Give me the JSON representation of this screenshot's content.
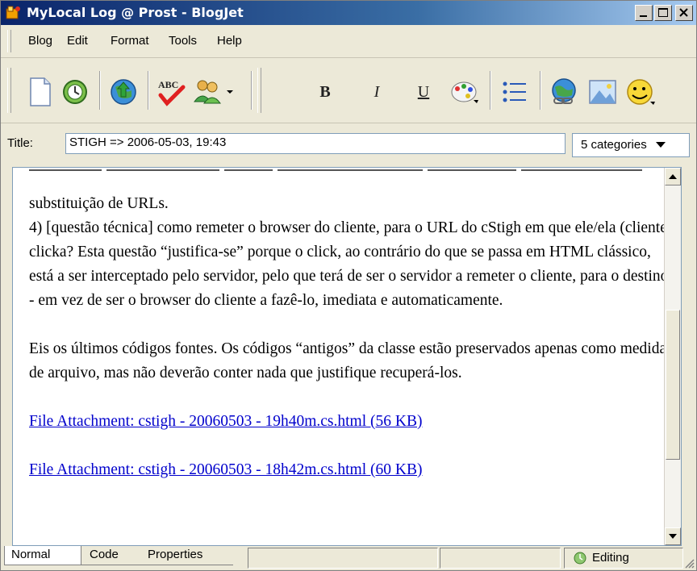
{
  "window": {
    "title": "MyLocal Log @ Prost - BlogJet"
  },
  "menu": {
    "items": [
      "Blog",
      "Edit",
      "Format",
      "Tools",
      "Help"
    ]
  },
  "toolbar": {
    "new_post_icon": "new-document-icon",
    "spell_label": "ABC",
    "bold_label": "B",
    "italic_label": "I",
    "underline_label": "U"
  },
  "post": {
    "title_label": "Title:",
    "title_value": "STIGH => 2006-05-03, 19:43",
    "categories_label": "5 categories"
  },
  "editor": {
    "paragraphs": [
      "substituição de URLs.",
      "4) [questão técnica] como remeter o browser do cliente, para o URL do cStigh em que ele/ela (cliente) clicka? Esta questão “justifica-se” porque o click, ao contrário do que se passa em HTML clássico, está a ser interceptado pelo servidor, pelo que terá de ser o servidor a remeter o cliente, para o destino - em vez de ser o browser do cliente a fazê-lo, imediata e automaticamente.",
      "Eis os últimos códigos fontes. Os códigos “antigos” da classe estão preservados apenas como medida de arquivo, mas não deverão conter nada que justifique recuperá-los."
    ],
    "attachments": [
      "File Attachment: cstigh - 20060503 - 19h40m.cs.html (56 KB)",
      "File Attachment: cstigh - 20060503 - 18h42m.cs.html (60 KB)"
    ]
  },
  "tabs": {
    "normal": "Normal",
    "code": "Code",
    "properties": "Properties"
  },
  "status": {
    "editing": "Editing"
  }
}
